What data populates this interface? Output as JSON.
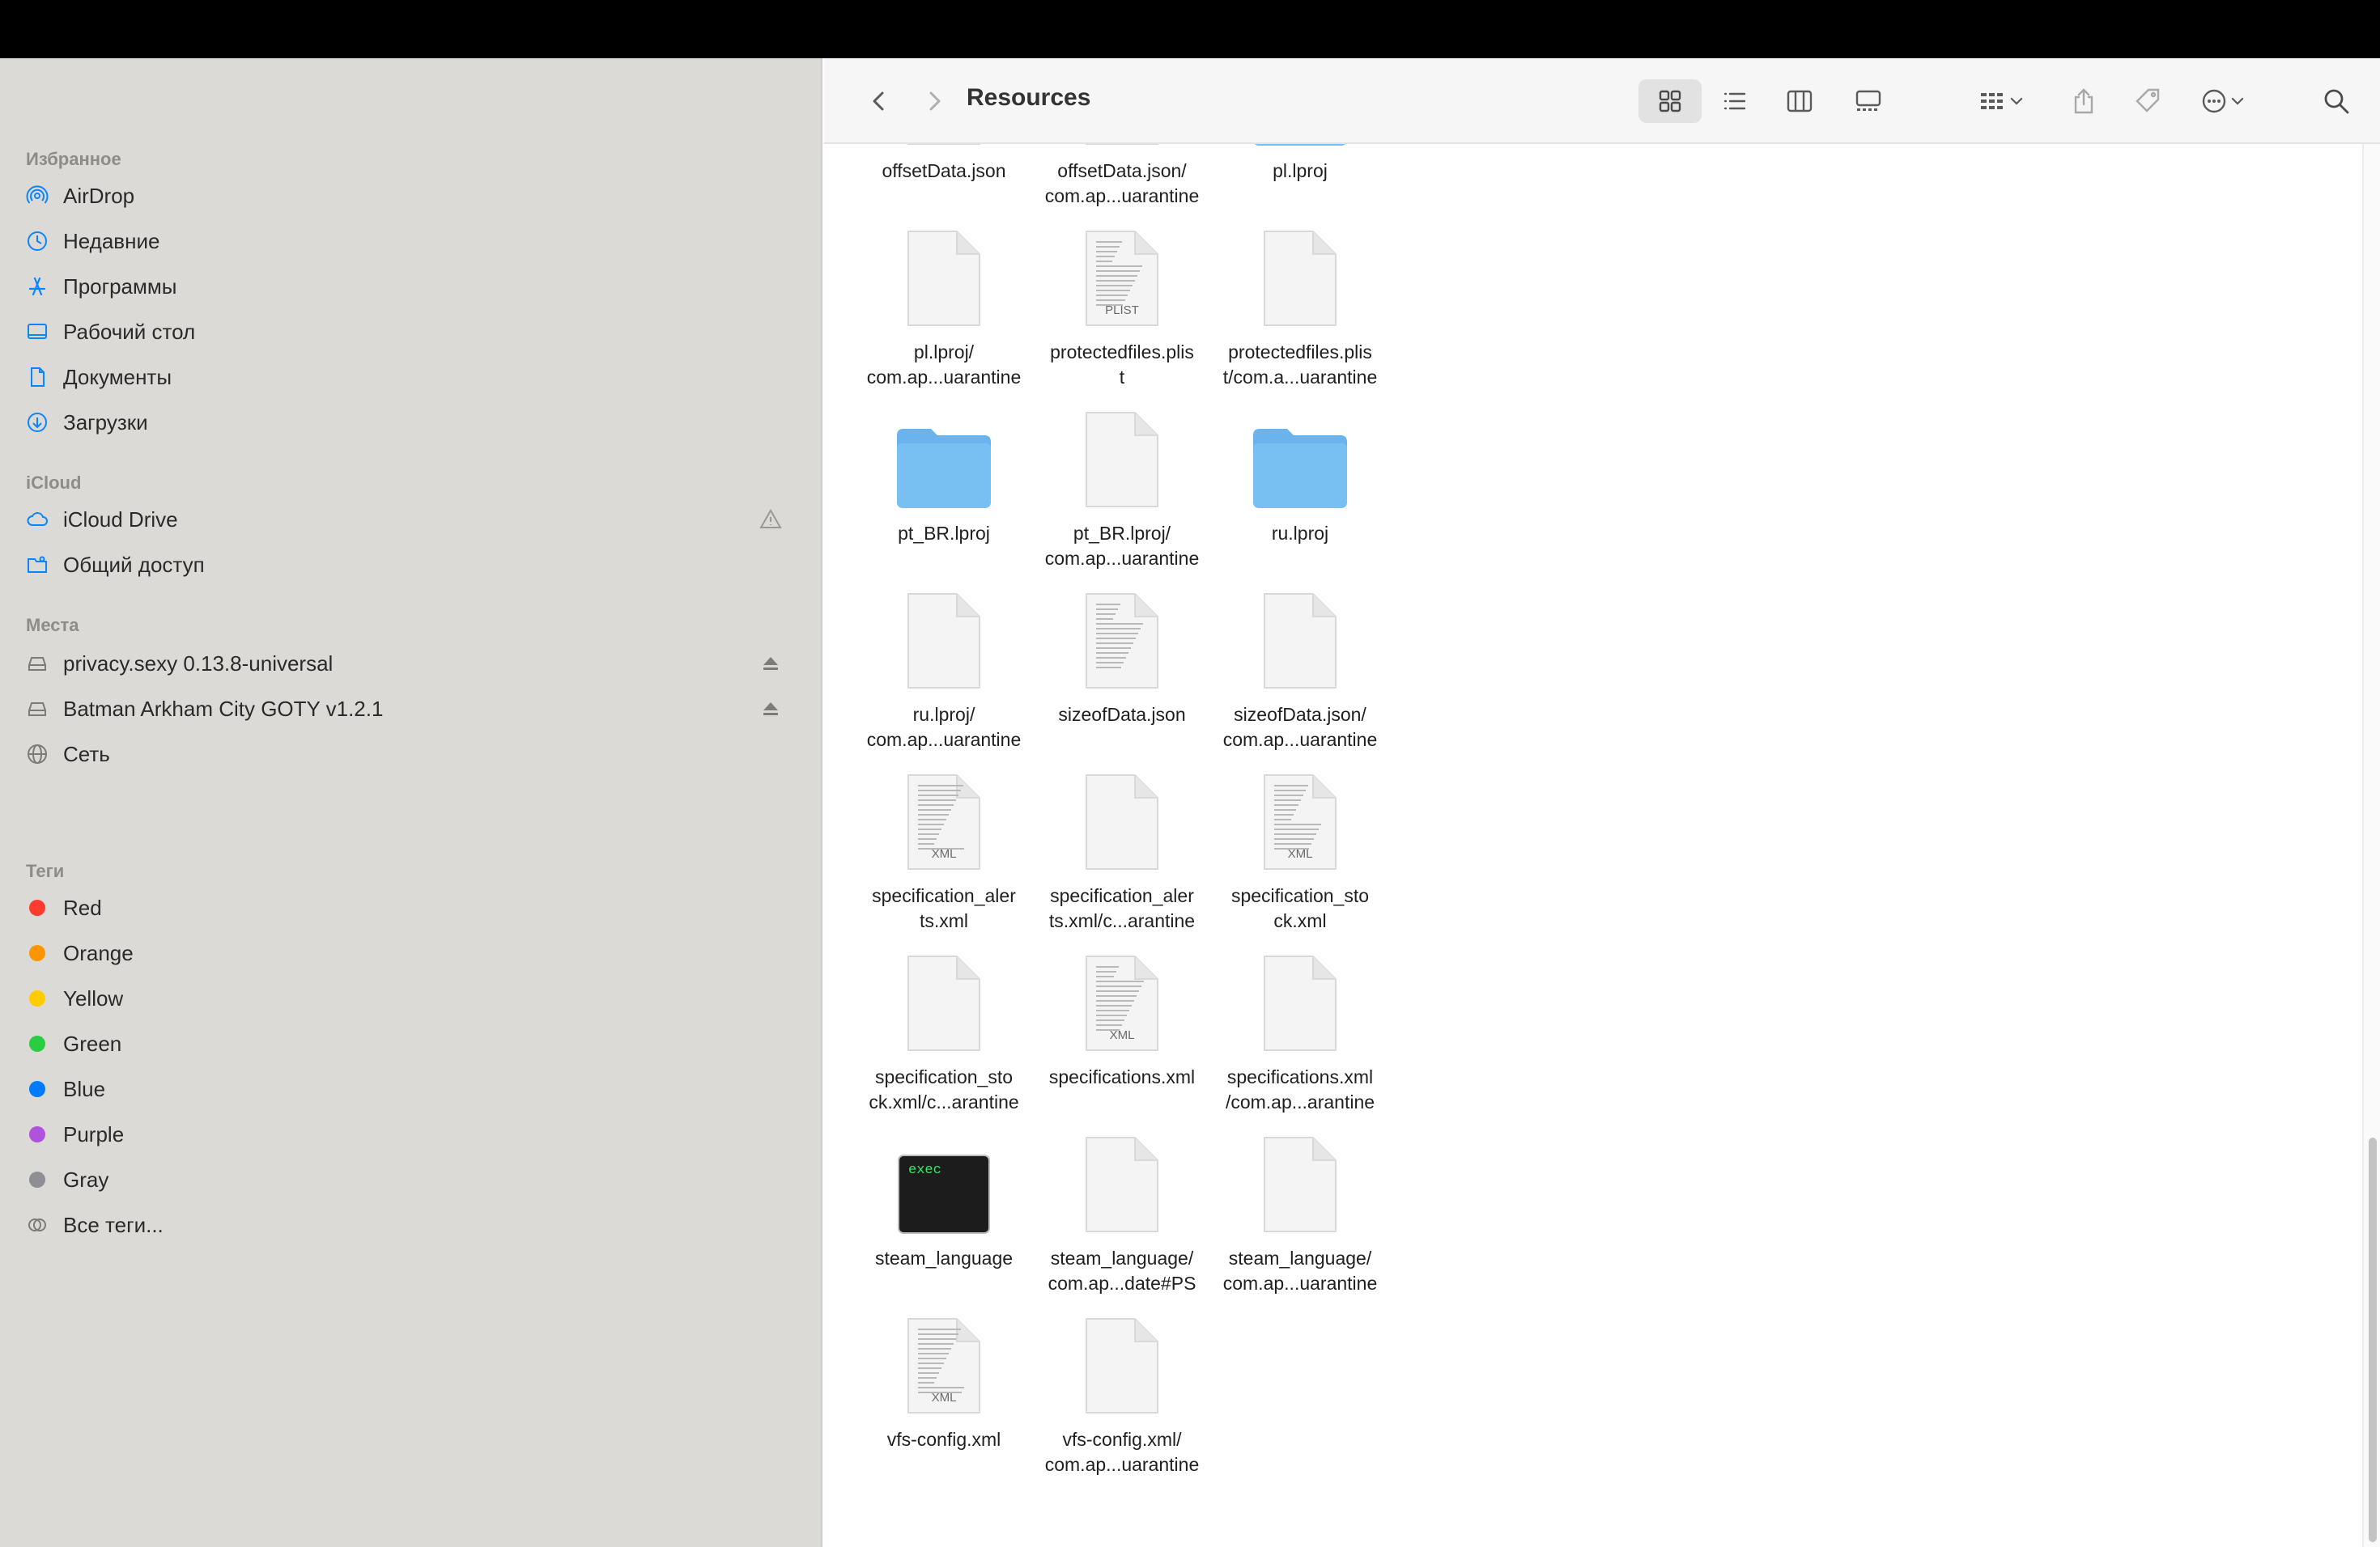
{
  "window": {
    "title": "Resources"
  },
  "sidebar": {
    "sections": [
      {
        "key": "favorites",
        "title": "Избранное",
        "items": [
          {
            "label": "AirDrop",
            "icon": "airdrop-icon"
          },
          {
            "label": "Недавние",
            "icon": "clock-icon"
          },
          {
            "label": "Программы",
            "icon": "apps-icon"
          },
          {
            "label": "Рабочий стол",
            "icon": "desktop-icon"
          },
          {
            "label": "Документы",
            "icon": "document-icon"
          },
          {
            "label": "Загрузки",
            "icon": "download-icon"
          }
        ]
      },
      {
        "key": "icloud",
        "title": "iCloud",
        "items": [
          {
            "label": "iCloud Drive",
            "icon": "cloud-icon"
          },
          {
            "label": "Общий доступ",
            "icon": "shared-folder-icon"
          }
        ]
      },
      {
        "key": "locations",
        "title": "Места",
        "items": [
          {
            "label": "privacy.sexy 0.13.8-universal",
            "icon": "disk-icon"
          },
          {
            "label": "Batman Arkham City GOTY v1.2.1",
            "icon": "disk-icon"
          },
          {
            "label": "Сеть",
            "icon": "network-icon"
          }
        ]
      },
      {
        "key": "tags",
        "title": "Теги",
        "items": [
          {
            "label": "Red",
            "color": "#ff3b30"
          },
          {
            "label": "Orange",
            "color": "#ff9500"
          },
          {
            "label": "Yellow",
            "color": "#ffcc00"
          },
          {
            "label": "Green",
            "color": "#28cd41"
          },
          {
            "label": "Blue",
            "color": "#007aff"
          },
          {
            "label": "Purple",
            "color": "#af52de"
          },
          {
            "label": "Gray",
            "color": "#8e8e93"
          },
          {
            "label": "Все теги...",
            "icon": "all-tags-icon"
          }
        ]
      }
    ]
  },
  "files": [
    {
      "name": "offsetData.json",
      "kind": "json"
    },
    {
      "name": "offsetData.json/\ncom.ap...uarantine",
      "kind": "blank"
    },
    {
      "name": "pl.lproj",
      "kind": "folder"
    },
    {
      "name": "pl.lproj/\ncom.ap...uarantine",
      "kind": "blank"
    },
    {
      "name": "protectedfiles.plis\nt",
      "kind": "plist",
      "badge": "PLIST"
    },
    {
      "name": "protectedfiles.plis\nt/com.a...uarantine",
      "kind": "blank"
    },
    {
      "name": "pt_BR.lproj",
      "kind": "folder"
    },
    {
      "name": "pt_BR.lproj/\ncom.ap...uarantine",
      "kind": "blank"
    },
    {
      "name": "ru.lproj",
      "kind": "folder"
    },
    {
      "name": "ru.lproj/\ncom.ap...uarantine",
      "kind": "blank"
    },
    {
      "name": "sizeofData.json",
      "kind": "json"
    },
    {
      "name": "sizeofData.json/\ncom.ap...uarantine",
      "kind": "blank"
    },
    {
      "name": "specification_aler\nts.xml",
      "kind": "xml",
      "badge": "XML"
    },
    {
      "name": "specification_aler\nts.xml/c...arantine",
      "kind": "blank"
    },
    {
      "name": "specification_sto\nck.xml",
      "kind": "xml",
      "badge": "XML"
    },
    {
      "name": "specification_sto\nck.xml/c...arantine",
      "kind": "blank"
    },
    {
      "name": "specifications.xml",
      "kind": "xml",
      "badge": "XML"
    },
    {
      "name": "specifications.xml\n/com.ap...arantine",
      "kind": "blank"
    },
    {
      "name": "steam_language",
      "kind": "exec",
      "badge": "exec"
    },
    {
      "name": "steam_language/\ncom.ap...date#PS",
      "kind": "blank"
    },
    {
      "name": "steam_language/\ncom.ap...uarantine",
      "kind": "blank"
    },
    {
      "name": "vfs-config.xml",
      "kind": "xml",
      "badge": "XML"
    },
    {
      "name": "vfs-config.xml/\ncom.ap...uarantine",
      "kind": "blank"
    }
  ],
  "colors": {
    "accent": "#0a84ff",
    "folder": "#6ab3ec",
    "sidebar_bg": "#dcdad7"
  }
}
